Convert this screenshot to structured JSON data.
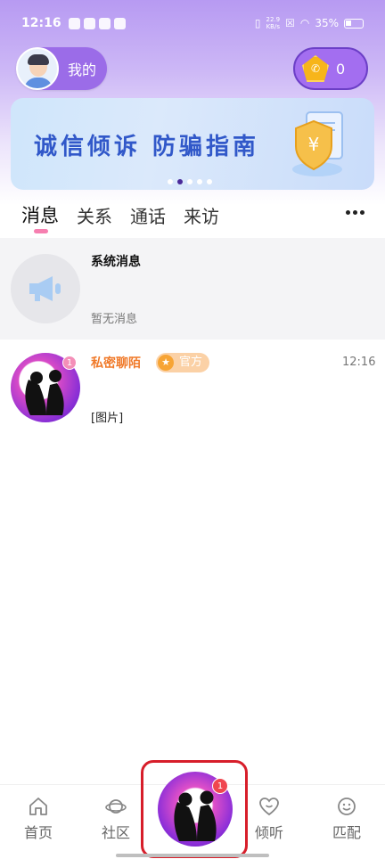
{
  "status_bar": {
    "time": "12:16",
    "net_speed_value": "22.9",
    "net_speed_unit": "KB/s",
    "battery": "35%"
  },
  "header": {
    "me_label": "我的",
    "coin_value": "0"
  },
  "banner": {
    "text": "诚信倾诉 防骗指南",
    "slides_total": 5,
    "active_slide": 1
  },
  "tabs": [
    {
      "label": "消息",
      "active": true
    },
    {
      "label": "关系",
      "active": false
    },
    {
      "label": "通话",
      "active": false
    },
    {
      "label": "来访",
      "active": false
    }
  ],
  "messages": {
    "system": {
      "title": "系统消息",
      "subtitle": "暂无消息"
    },
    "chat": {
      "name": "私密聊陌",
      "tag": "官方",
      "time": "12:16",
      "preview": "[图片]",
      "unread": "1"
    }
  },
  "bottom_nav": {
    "home": "首页",
    "community": "社区",
    "center_badge": "1",
    "listen": "倾听",
    "match": "匹配"
  },
  "colors": {
    "accent_purple": "#9b6ce8",
    "official_orange": "#f07a2a",
    "highlight_red": "#d71e2a",
    "banner_blue": "#3158c9"
  }
}
